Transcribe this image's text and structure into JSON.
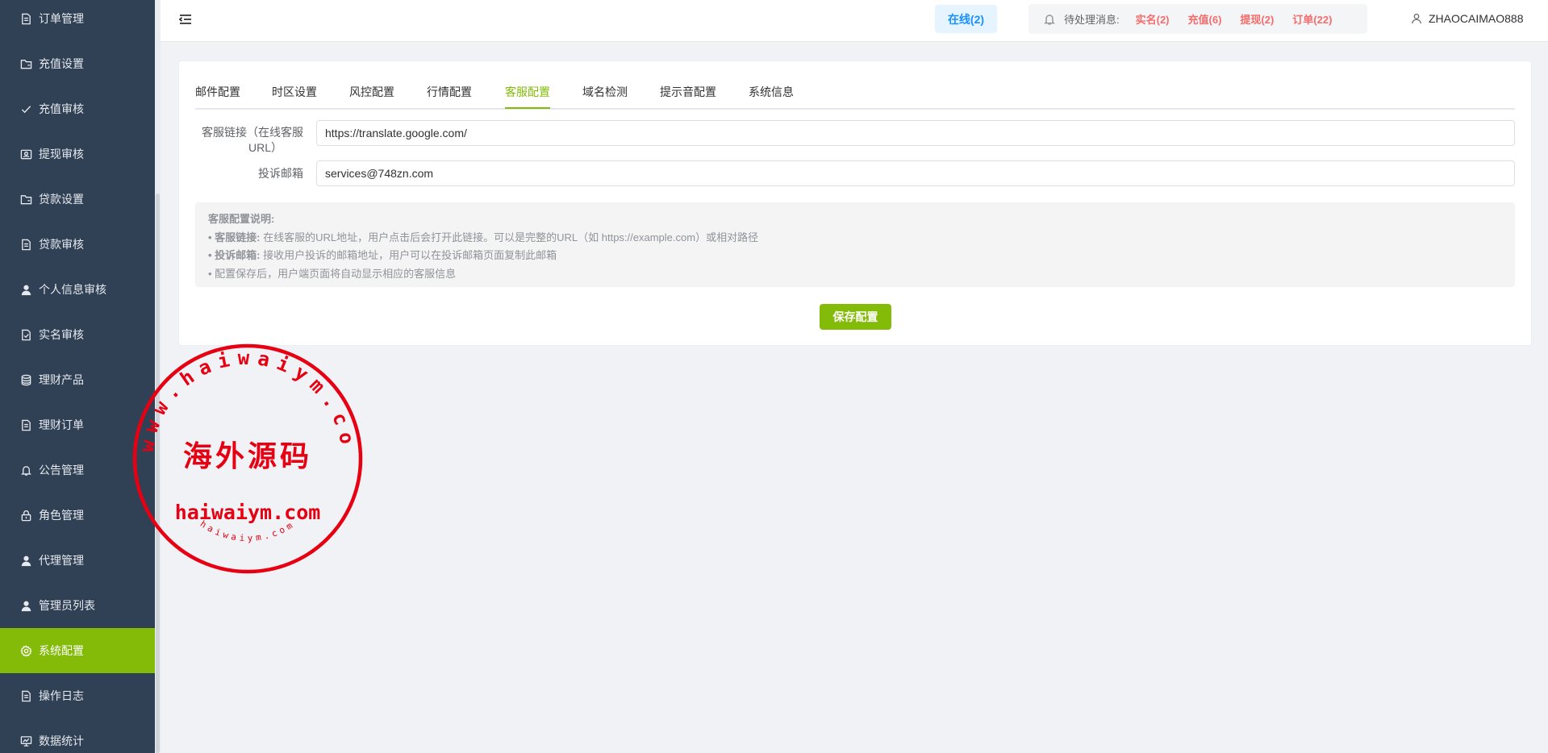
{
  "sidebar": {
    "items": [
      {
        "label": "订单管理",
        "icon": "document-icon"
      },
      {
        "label": "充值设置",
        "icon": "folder-icon"
      },
      {
        "label": "充值审核",
        "icon": "check-icon"
      },
      {
        "label": "提现审核",
        "icon": "withdraw-icon"
      },
      {
        "label": "贷款设置",
        "icon": "folder-icon"
      },
      {
        "label": "贷款审核",
        "icon": "document-icon"
      },
      {
        "label": "个人信息审核",
        "icon": "user-icon"
      },
      {
        "label": "实名审核",
        "icon": "document-check-icon"
      },
      {
        "label": "理财产品",
        "icon": "coins-icon"
      },
      {
        "label": "理财订单",
        "icon": "document-icon"
      },
      {
        "label": "公告管理",
        "icon": "bell-icon"
      },
      {
        "label": "角色管理",
        "icon": "lock-icon"
      },
      {
        "label": "代理管理",
        "icon": "user-icon"
      },
      {
        "label": "管理员列表",
        "icon": "user-icon"
      },
      {
        "label": "系统配置",
        "icon": "gear-icon",
        "active": true
      },
      {
        "label": "操作日志",
        "icon": "document-icon"
      },
      {
        "label": "数据统计",
        "icon": "chart-icon"
      }
    ]
  },
  "header": {
    "online_label": "在线(2)",
    "notice_title": "待处理消息:",
    "notices": [
      "实名(2)",
      "充值(6)",
      "提现(2)",
      "订单(22)"
    ],
    "username": "ZHAOCAIMAO888"
  },
  "tabs": [
    "邮件配置",
    "时区设置",
    "风控配置",
    "行情配置",
    "客服配置",
    "域名检测",
    "提示音配置",
    "系统信息"
  ],
  "active_tab": "客服配置",
  "form": {
    "service_link_label_line1": "客服链接（在线客服",
    "service_link_label_line2": "URL）",
    "service_link_value": "https://translate.google.com/",
    "complaint_email_label": "投诉邮箱",
    "complaint_email_value": "services@748zn.com"
  },
  "help": {
    "title": "客服配置说明:",
    "line1_key": "• 客服链接:",
    "line1_text": " 在线客服的URL地址，用户点击后会打开此链接。可以是完整的URL（如 https://example.com）或相对路径",
    "line2_key": "• 投诉邮箱:",
    "line2_text": " 接收用户投诉的邮箱地址，用户可以在投诉邮箱页面复制此邮箱",
    "line3_text": "• 配置保存后，用户端页面将自动显示相应的客服信息"
  },
  "save_label": "保存配置",
  "watermark": {
    "center_text": "海外源码",
    "domain_text": "haiwaiym.com",
    "ring_text": "www.haiwaiym.com",
    "bottom_text": "haiwaiym.com"
  },
  "colors": {
    "sidebar_bg": "#304156",
    "accent": "#83bb08",
    "notice_red": "#f56c6c",
    "online_blue": "#1890ff",
    "stamp_red": "#e60012"
  }
}
